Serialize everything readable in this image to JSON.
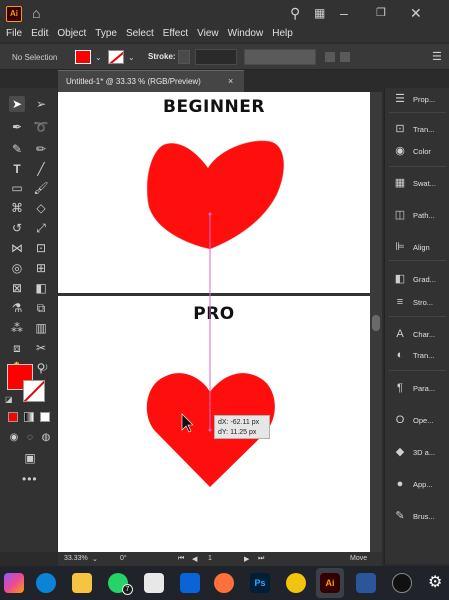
{
  "app": {
    "logo": "Ai"
  },
  "menu": [
    "File",
    "Edit",
    "Object",
    "Type",
    "Select",
    "Effect",
    "View",
    "Window",
    "Help"
  ],
  "control_bar": {
    "selection_label": "No Selection",
    "stroke_label": "Stroke:",
    "fill_color": "#ff0000"
  },
  "document_tab": {
    "label": "Untitled-1* @ 33.33 % (RGB/Preview)",
    "close": "×"
  },
  "canvas": {
    "top_label": "BEGINNER",
    "bottom_label": "PRO",
    "heart_color": "#ff0e0e",
    "guide_color": "#e066c8",
    "tooltip": {
      "dx": "dX: -62.11 px",
      "dy": "dY: 11.25 px"
    }
  },
  "status": {
    "zoom": "33.33%",
    "rotation": "0°",
    "artboard": "1",
    "tool": "Move"
  },
  "right_panel": [
    {
      "icon": "properties-icon",
      "label": "Prop..."
    },
    {
      "icon": "transform-icon",
      "label": "Tran..."
    },
    {
      "icon": "color-icon",
      "label": "Color"
    },
    {
      "icon": "swatches-icon",
      "label": "Swat..."
    },
    {
      "icon": "pathfinder-icon",
      "label": "Path..."
    },
    {
      "icon": "align-icon",
      "label": "Align"
    },
    {
      "icon": "gradient-icon",
      "label": "Grad..."
    },
    {
      "icon": "stroke-icon",
      "label": "Stro..."
    },
    {
      "icon": "character-icon",
      "label": "Char..."
    },
    {
      "icon": "transparency-icon",
      "label": "Tran..."
    },
    {
      "icon": "paragraph-icon",
      "label": "Para..."
    },
    {
      "icon": "opentype-icon",
      "label": "Ope..."
    },
    {
      "icon": "3d-icon",
      "label": "3D a..."
    },
    {
      "icon": "appearance-icon",
      "label": "App..."
    },
    {
      "icon": "brushes-icon",
      "label": "Brus..."
    }
  ],
  "taskbar": {
    "whatsapp_badge": "7",
    "photoshop_label": "Ps",
    "illustrator_label": "Ai"
  }
}
